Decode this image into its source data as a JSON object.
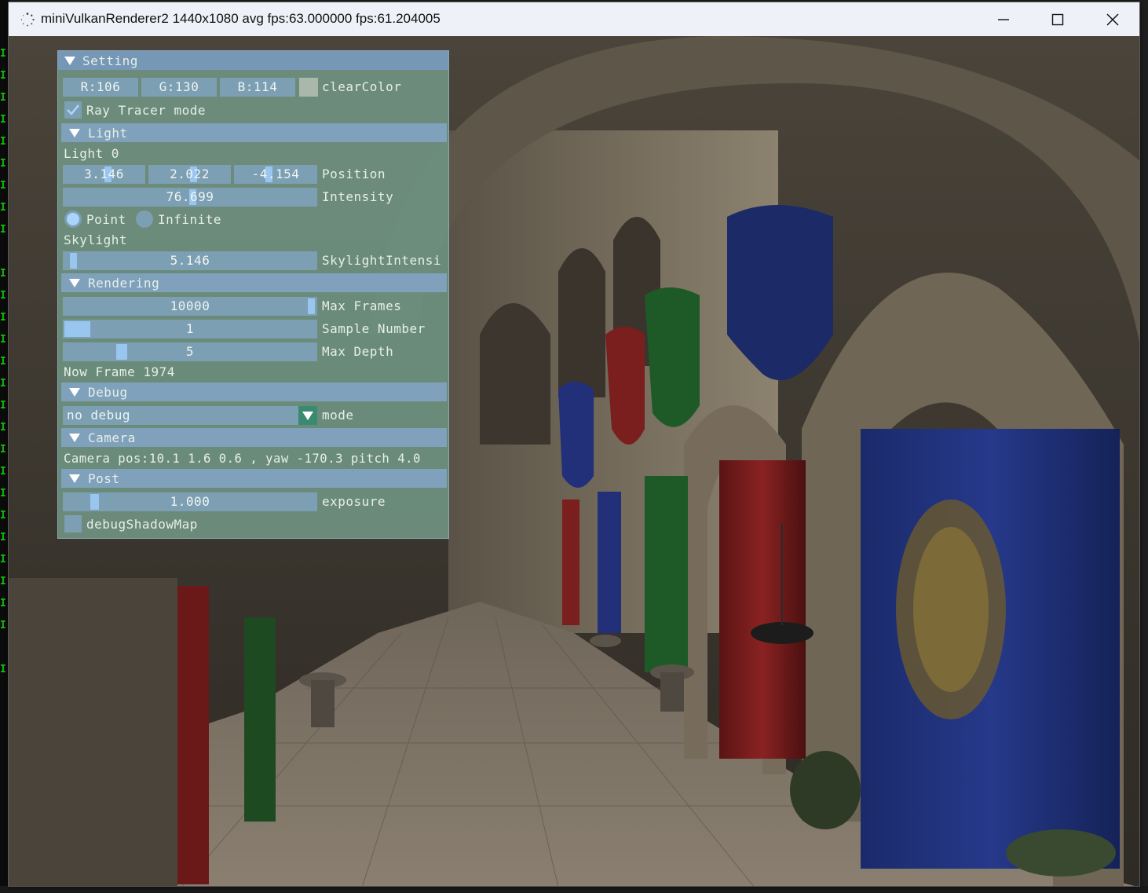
{
  "window": {
    "title": "miniVulkanRenderer2 1440x1080 avg fps:63.000000 fps:61.204005",
    "controls": [
      "minimize",
      "maximize",
      "close"
    ]
  },
  "setting_panel": {
    "title": "Setting",
    "clear_color": {
      "r": "R:106",
      "g": "G:130",
      "b": "B:114",
      "swatch": "#6a8272",
      "label": "clearColor"
    },
    "ray_tracer": {
      "label": "Ray Tracer mode",
      "checked": true
    },
    "light": {
      "header": "Light",
      "light0_label": "Light 0",
      "position": {
        "x": "3.146",
        "y": "2.022",
        "z": "-4.154",
        "label": "Position"
      },
      "intensity": {
        "value": "76.699",
        "label": "Intensity"
      },
      "type": {
        "point": "Point",
        "infinite": "Infinite",
        "selected": "Point"
      },
      "skylight_label": "Skylight",
      "skylight_intensity": {
        "value": "5.146",
        "label": "SkylightIntensi"
      }
    },
    "rendering": {
      "header": "Rendering",
      "max_frames": {
        "value": "10000",
        "label": "Max Frames"
      },
      "sample_number": {
        "value": "1",
        "label": "Sample Number"
      },
      "max_depth": {
        "value": "5",
        "label": "Max Depth"
      },
      "now_frame": "Now Frame 1974"
    },
    "debug": {
      "header": "Debug",
      "mode_value": "no debug",
      "mode_label": "mode"
    },
    "camera": {
      "header": "Camera",
      "info": "Camera pos:10.1 1.6 0.6 , yaw -170.3 pitch 4.0"
    },
    "post": {
      "header": "Post",
      "exposure": {
        "value": "1.000",
        "label": "exposure"
      },
      "debug_shadow_map": {
        "label": "debugShadowMap",
        "checked": false
      }
    }
  },
  "colors": {
    "titlebar": "#eef2f8",
    "panel_bg": "#6f9180",
    "header_bg": "#7fa1bb",
    "frame_bg": "#7d9fb3",
    "slider_grab": "#99c6ef",
    "check_mark": "#a9d4fb",
    "terminal_green": "#16c60c"
  }
}
